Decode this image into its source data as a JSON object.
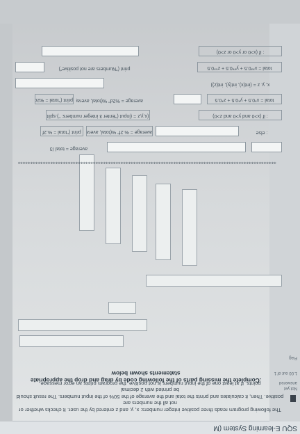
{
  "site": {
    "title": "SQU E-learning System (M"
  },
  "question_meta": {
    "status": "Not yet answered",
    "marks": "1.00 out of 1",
    "flag": "Flag"
  },
  "instructions": {
    "para": [
      "The following program reads three positive integer numbers: x, y, and z entered by the user. It checks whether or not all the numbers are",
      "positive. Then, it calculates and prints the total and the average of the 50% of the input numbers. The result should be printed with 2 decimal",
      "points. If at least one of the input numbers is not positive, the program prints an error message."
    ],
    "task": ".Complete the missing parts of the following code by drag and drop the appropriate statements shown below"
  },
  "separator": "**********************************************************************************************************",
  "statements": {
    "s1": "average = total /3",
    "s2": "print (\"total = %.2f",
    "s3": "average = %.2f\" %(total, average))",
    "s4": ": else",
    "s5": "(x,y,z = (input (\"Enter 3 integer numbers: \").split",
    "s6": ": if (x>0 and y>0 and z>0)",
    "s7": "print (\"total = %2d",
    "s8": "average = %2d\" %(total, average))",
    "s9": "total = x*0.5 + y*0.5 + z*0.5",
    "s10": "x, y, z = (int(x), int(y), int(z))",
    "s11": "print (\"Numbers are not positive\")",
    "s12": "total = x**0.5 + y**0.5 + z**0.5",
    "s13": ": if (x>0 or y>0 or z>0)"
  }
}
